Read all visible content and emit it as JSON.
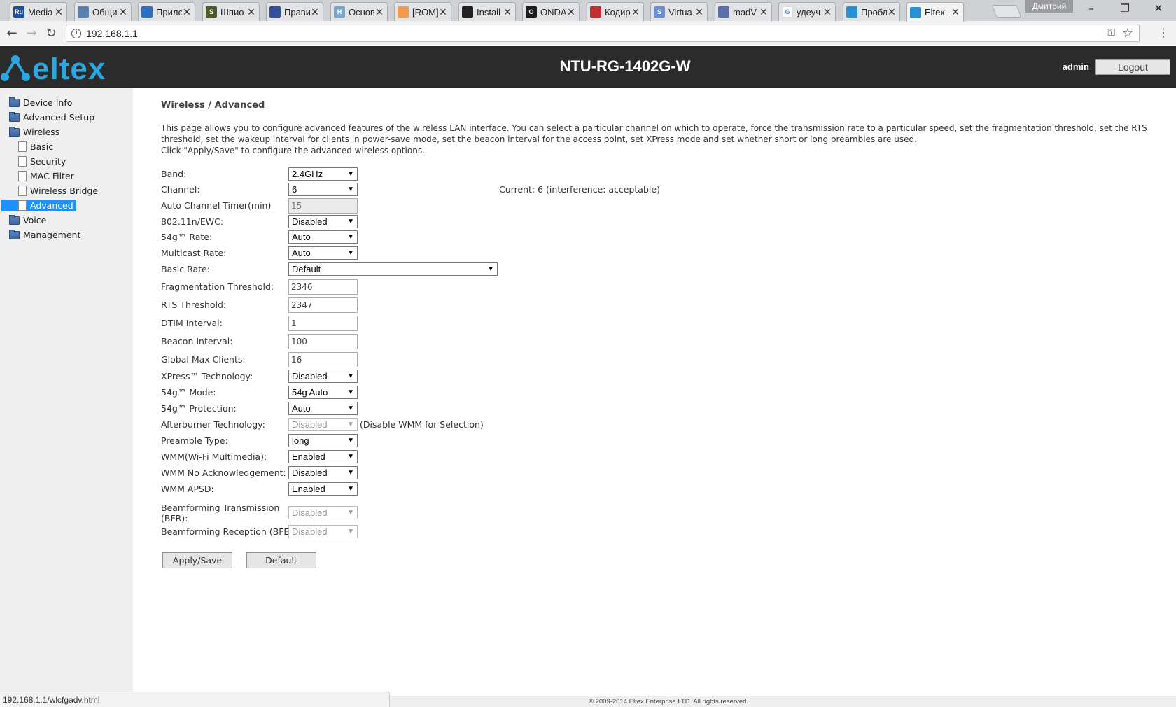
{
  "browser": {
    "tabs": [
      {
        "title": "Media",
        "icon": "rutracker-icon",
        "color": "#1c4f9c",
        "glyph": "Ru"
      },
      {
        "title": "Общи",
        "icon": "forum-icon",
        "color": "#5c7fb0",
        "glyph": ""
      },
      {
        "title": "Прило",
        "icon": "blue-square-icon",
        "color": "#2d6fc0",
        "glyph": ""
      },
      {
        "title": "Шпио",
        "icon": "s-icon",
        "color": "#4b5b2a",
        "glyph": "S"
      },
      {
        "title": "Прави",
        "icon": "diamond-icon",
        "color": "#36509a",
        "glyph": ""
      },
      {
        "title": "Основ",
        "icon": "h-icon",
        "color": "#7aa7c7",
        "glyph": "H"
      },
      {
        "title": "[ROM]",
        "icon": "xda-icon",
        "color": "#f09a50",
        "glyph": ""
      },
      {
        "title": "Install",
        "icon": "github-icon",
        "color": "#222222",
        "glyph": ""
      },
      {
        "title": "ONDA",
        "icon": "onda-icon",
        "color": "#1a1a1a",
        "glyph": "O"
      },
      {
        "title": "Кодир",
        "icon": "ball-icon",
        "color": "#c03030",
        "glyph": ""
      },
      {
        "title": "Virtua",
        "icon": "s-stack-icon",
        "color": "#6a8ed6",
        "glyph": "S"
      },
      {
        "title": "madV",
        "icon": "chart-icon",
        "color": "#5a6ea8",
        "glyph": ""
      },
      {
        "title": "удеуч",
        "icon": "google-icon",
        "color": "#ffffff",
        "glyph": "G"
      },
      {
        "title": "Пробл",
        "icon": "eltex-icon",
        "color": "#2c8fd0",
        "glyph": ""
      },
      {
        "title": "Eltex -",
        "icon": "eltex-icon",
        "color": "#2c8fd0",
        "glyph": "",
        "active": true
      }
    ],
    "user_name": "Дмитрий",
    "url": "192.168.1.1",
    "status_url": "192.168.1.1/wlcfgadv.html"
  },
  "header": {
    "brand": "eltex",
    "device_name": "NTU-RG-1402G-W",
    "user": "admin",
    "logout_label": "Logout",
    "brand_color": "#2aa7e0"
  },
  "sidebar": {
    "items": [
      {
        "label": "Device Info",
        "type": "folder"
      },
      {
        "label": "Advanced Setup",
        "type": "folder"
      },
      {
        "label": "Wireless",
        "type": "folder"
      },
      {
        "label": "Basic",
        "type": "page"
      },
      {
        "label": "Security",
        "type": "page"
      },
      {
        "label": "MAC Filter",
        "type": "page"
      },
      {
        "label": "Wireless Bridge",
        "type": "page"
      },
      {
        "label": "Advanced",
        "type": "page",
        "selected": true
      },
      {
        "label": "Voice",
        "type": "folder"
      },
      {
        "label": "Management",
        "type": "folder"
      }
    ]
  },
  "main": {
    "title": "Wireless / Advanced",
    "description": [
      "This page allows you to configure advanced features of the wireless LAN interface. You can select a particular channel on which to operate, force the transmission rate to a particular speed, set the fragmentation threshold, set the RTS threshold, set the wakeup interval for clients in power-save mode, set the beacon interval for the access point, set XPress mode and set whether short or long preambles are used.",
      "Click \"Apply/Save\" to configure the advanced wireless options."
    ],
    "fields": {
      "band": {
        "label": "Band:",
        "value": "2.4GHz"
      },
      "channel": {
        "label": "Channel:",
        "value": "6",
        "current": "Current: 6 (interference: acceptable)"
      },
      "auto_channel_timer": {
        "label": "Auto Channel Timer(min)",
        "value": "15"
      },
      "ewc": {
        "label": "802.11n/EWC:",
        "value": "Disabled"
      },
      "rate_54g": {
        "label": "54g™ Rate:",
        "value": "Auto"
      },
      "multicast_rate": {
        "label": "Multicast Rate:",
        "value": "Auto"
      },
      "basic_rate": {
        "label": "Basic Rate:",
        "value": "Default"
      },
      "frag_threshold": {
        "label": "Fragmentation Threshold:",
        "value": "2346"
      },
      "rts_threshold": {
        "label": "RTS Threshold:",
        "value": "2347"
      },
      "dtim_interval": {
        "label": "DTIM Interval:",
        "value": "1"
      },
      "beacon_interval": {
        "label": "Beacon Interval:",
        "value": "100"
      },
      "global_max_clients": {
        "label": "Global Max Clients:",
        "value": "16"
      },
      "xpress": {
        "label": "XPress™ Technology:",
        "value": "Disabled"
      },
      "mode_54g": {
        "label": "54g™ Mode:",
        "value": "54g Auto"
      },
      "protection_54g": {
        "label": "54g™ Protection:",
        "value": "Auto"
      },
      "afterburner": {
        "label": "Afterburner Technology:",
        "value": "Disabled",
        "hint": "(Disable WMM for Selection)"
      },
      "preamble": {
        "label": "Preamble Type:",
        "value": "long"
      },
      "wmm": {
        "label": "WMM(Wi-Fi Multimedia):",
        "value": "Enabled"
      },
      "wmm_noack": {
        "label": "WMM No Acknowledgement:",
        "value": "Disabled"
      },
      "wmm_apsd": {
        "label": "WMM APSD:",
        "value": "Enabled"
      },
      "bfr": {
        "label": "Beamforming Transmission (BFR):",
        "value": "Disabled"
      },
      "bfe": {
        "label": "Beamforming Reception (BFE):",
        "value": "Disabled"
      }
    },
    "apply_label": "Apply/Save",
    "default_label": "Default"
  },
  "footer": {
    "copyright": "© 2009-2014 Eltex Enterprise LTD. All rights reserved."
  }
}
